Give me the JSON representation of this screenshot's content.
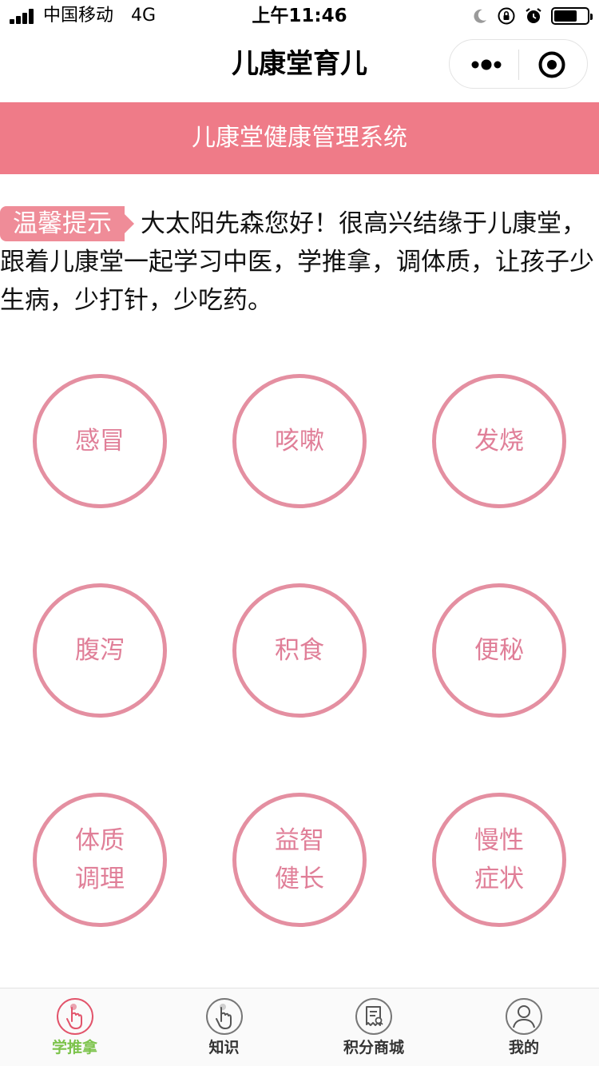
{
  "status_bar": {
    "carrier": "中国移动",
    "network": "4G",
    "time": "上午11:46"
  },
  "nav": {
    "title": "儿康堂育儿"
  },
  "banner": {
    "title": "儿康堂健康管理系统"
  },
  "tip": {
    "badge": "温馨提示",
    "message": "大太阳先森您好！很高兴结缘于儿康堂，跟着儿康堂一起学习中医，学推拿，调体质，让孩子少生病，少打针，少吃药。"
  },
  "categories": [
    {
      "label": "感冒"
    },
    {
      "label": "咳嗽"
    },
    {
      "label": "发烧"
    },
    {
      "label": "腹泻"
    },
    {
      "label": "积食"
    },
    {
      "label": "便秘"
    },
    {
      "label": "体质调理"
    },
    {
      "label": "益智健长"
    },
    {
      "label": "慢性症状"
    }
  ],
  "tabbar": {
    "items": [
      {
        "label": "学推拿",
        "icon": "hand-massage-icon",
        "active": true
      },
      {
        "label": "知识",
        "icon": "hand-knowledge-icon",
        "active": false
      },
      {
        "label": "积分商城",
        "icon": "receipt-icon",
        "active": false
      },
      {
        "label": "我的",
        "icon": "user-icon",
        "active": false
      }
    ]
  },
  "colors": {
    "banner": "#ef7b88",
    "circle_border": "#e48fa1",
    "circle_text": "#e07f98",
    "tab_active": "#7cc34b"
  }
}
